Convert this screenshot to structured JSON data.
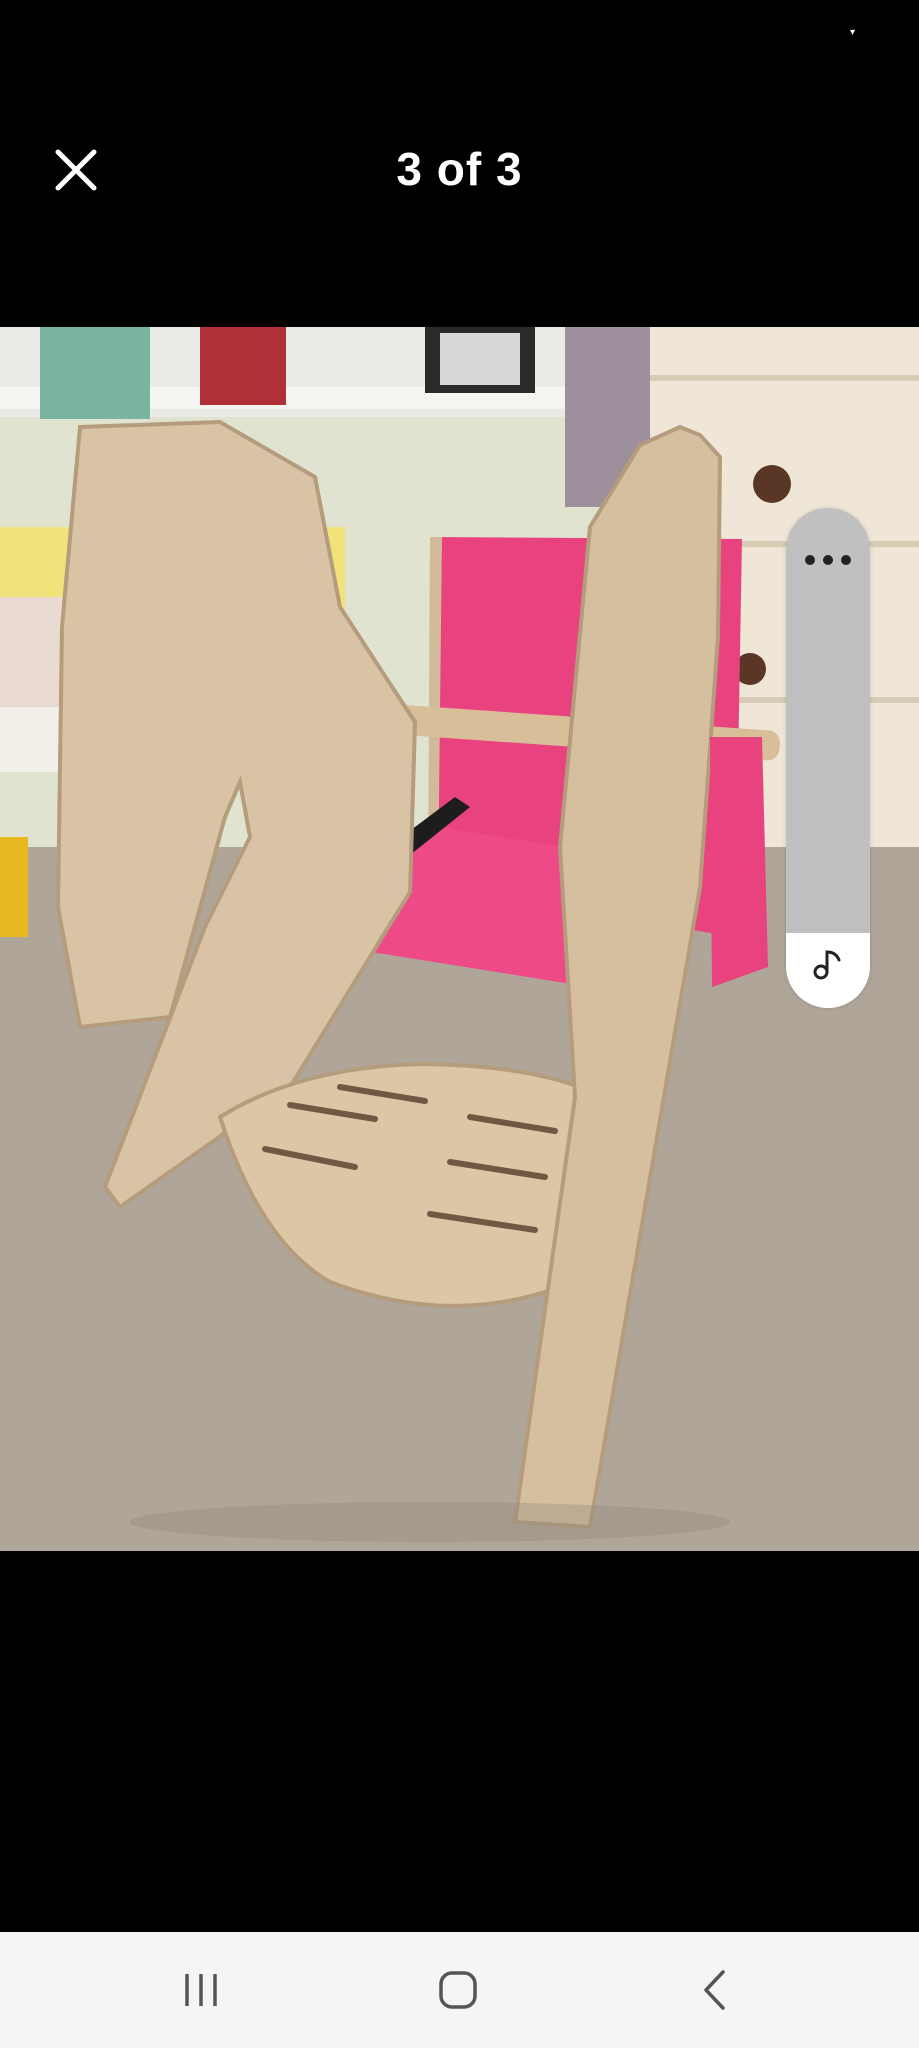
{
  "viewer": {
    "counter_text": "3 of 3"
  },
  "icons": {
    "close": "close-icon",
    "more": "more-horizontal-icon",
    "music": "music-note-icon",
    "recents": "recent-apps-icon",
    "home": "home-icon",
    "back": "back-icon"
  },
  "media_control": {
    "level_fraction": 0.15
  },
  "colors": {
    "background": "#000000",
    "nav_bar": "#f5f5f7",
    "control_track": "#c0c0c0",
    "control_fill": "#ffffff",
    "cushion_pink": "#e8437f",
    "plywood": "#d9c3a5"
  }
}
